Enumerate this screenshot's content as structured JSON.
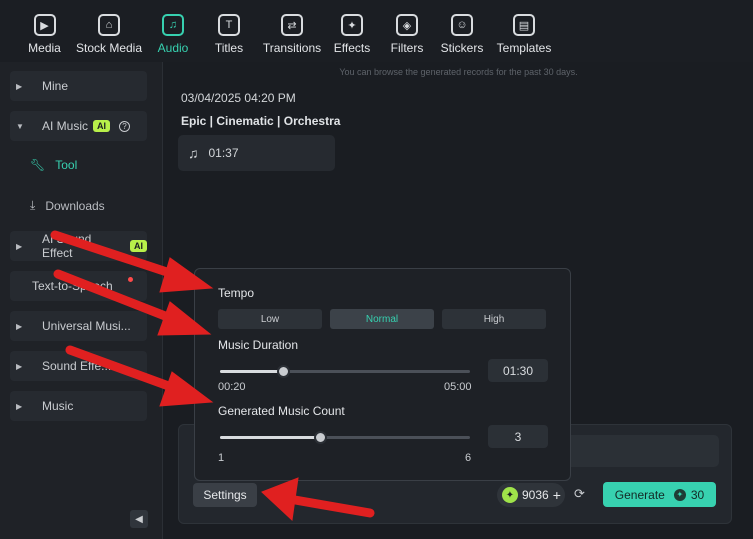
{
  "toolbar": {
    "items": [
      {
        "label": "Media",
        "icon": "media-icon",
        "glyph": "▶"
      },
      {
        "label": "Stock Media",
        "icon": "stock-media-icon",
        "glyph": "⌂"
      },
      {
        "label": "Audio",
        "icon": "music-note-icon",
        "glyph": "♫"
      },
      {
        "label": "Titles",
        "icon": "titles-icon",
        "glyph": "T"
      },
      {
        "label": "Transitions",
        "icon": "transitions-icon",
        "glyph": "⇄"
      },
      {
        "label": "Effects",
        "icon": "effects-icon",
        "glyph": "✦"
      },
      {
        "label": "Filters",
        "icon": "filters-icon",
        "glyph": "◈"
      },
      {
        "label": "Stickers",
        "icon": "stickers-icon",
        "glyph": "☺"
      },
      {
        "label": "Templates",
        "icon": "templates-icon",
        "glyph": "▤"
      }
    ],
    "active": "Audio"
  },
  "sidebar": {
    "mine": "Mine",
    "ai_music": "AI Music",
    "ai_badge": "AI",
    "tool": "Tool",
    "downloads": "Downloads",
    "ai_sound_effect": "AI Sound Effect",
    "text_to_speech": "Text-to-Speech",
    "universal_music": "Universal Musi...",
    "sound_effects": "Sound Effe...",
    "music": "Music"
  },
  "main": {
    "records_note": "You can browse the generated records for the past 30 days.",
    "record_date": "03/04/2025 04:20 PM",
    "record_title": "Epic | Cinematic | Orchestra",
    "track_duration": "01:37"
  },
  "settings_popup": {
    "tempo_label": "Tempo",
    "tempo_options": [
      "Low",
      "Normal",
      "High"
    ],
    "tempo_selected": "Normal",
    "duration_label": "Music Duration",
    "duration_value": "01:30",
    "duration_min": "00:20",
    "duration_max": "05:00",
    "duration_fraction": 0.25,
    "count_label": "Generated Music Count",
    "count_value": "3",
    "count_min": "1",
    "count_max": "6",
    "count_fraction": 0.4
  },
  "bottom_bar": {
    "settings_label": "Settings",
    "credits": "9036",
    "generate_label": "Generate",
    "generate_cost": "30"
  },
  "colors": {
    "accent": "#37d1b0",
    "annotation_arrow": "#e02020"
  }
}
